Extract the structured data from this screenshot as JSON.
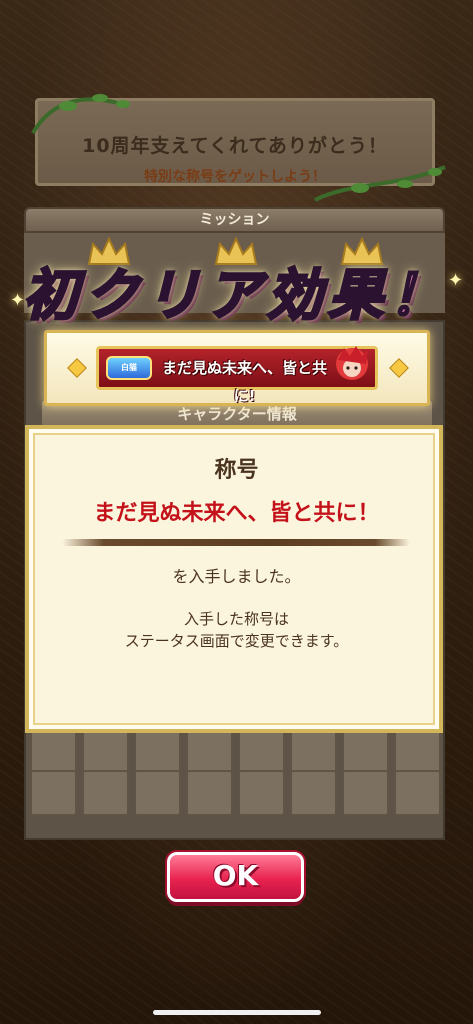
{
  "banner": {
    "line1": "10周年支えてくれてありがとう！",
    "line2": "特別な称号をゲットしよう！"
  },
  "mission": {
    "label": "ミッション"
  },
  "character_panel": {
    "header": "キャラクター情報"
  },
  "first_clear": {
    "text": "初クリア効果！"
  },
  "title_plate": {
    "logo_text": "白猫",
    "title": "まだ見ぬ未来へ、皆と共に!"
  },
  "dialog": {
    "heading": "称号",
    "title_name": "まだ見ぬ未来へ、皆と共に！",
    "obtained": "を入手しました。",
    "note_line1": "入手した称号は",
    "note_line2": "ステータス画面で変更できます。"
  },
  "ok_button": {
    "label": "OK"
  },
  "colors": {
    "title_red": "#c4121b",
    "ok_pink": "#e8234f",
    "frame_gold": "#d4b65a",
    "first_clear_pink": "#d77ba8"
  }
}
